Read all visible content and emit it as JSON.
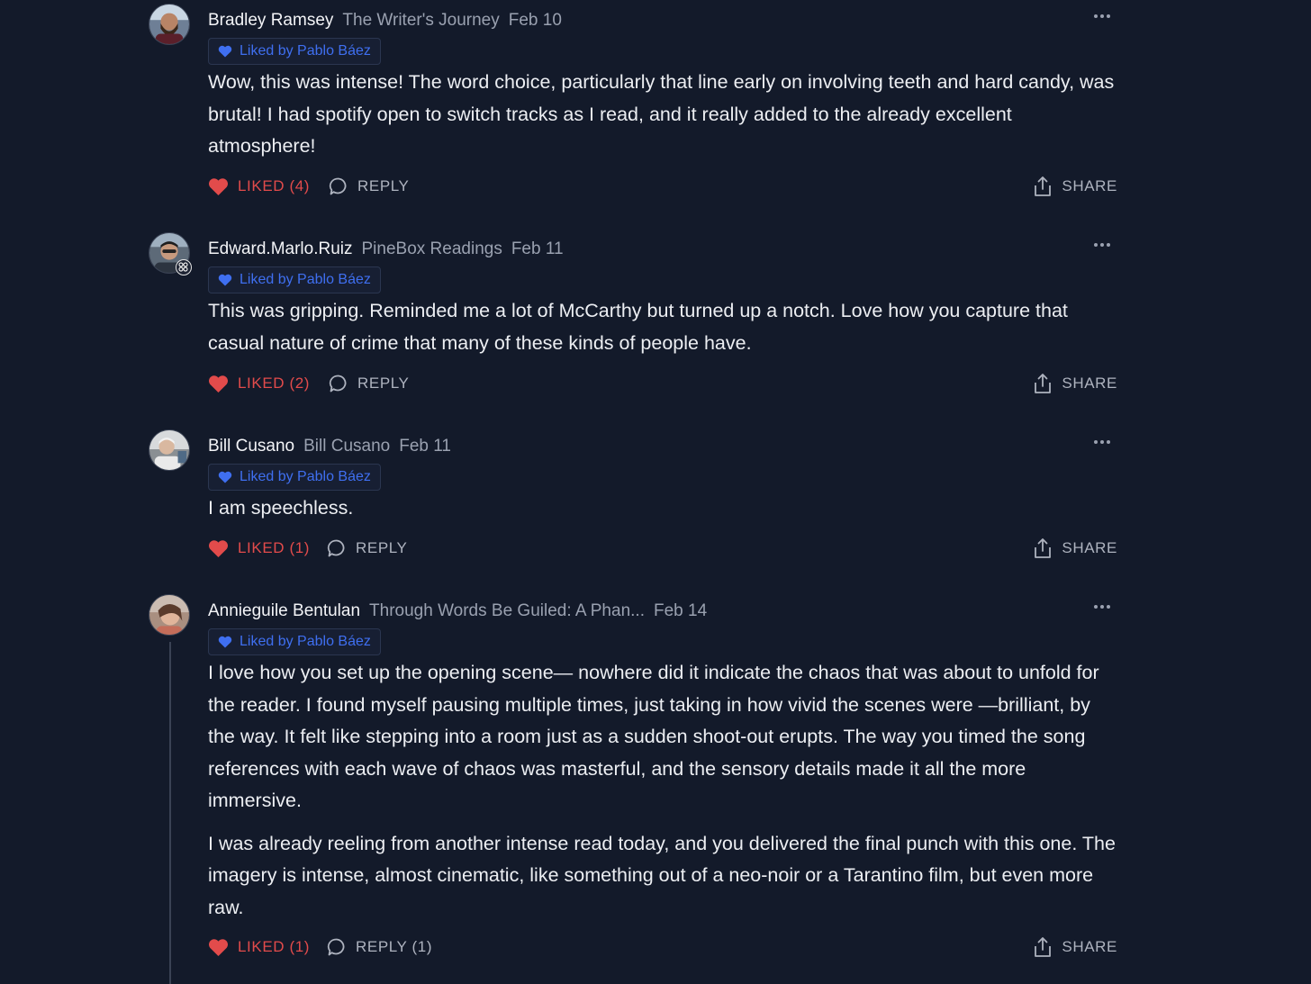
{
  "comments": [
    {
      "author": "Bradley Ramsey",
      "publication": "The Writer's Journey",
      "date": "Feb 10",
      "liked_badge": "Liked by Pablo Báez",
      "body": [
        "Wow, this was intense! The word choice, particularly that line early on involving teeth and hard candy, was brutal! I had spotify open to switch tracks as I read, and it really added to the already excellent atmosphere!"
      ],
      "like_label": "LIKED (4)",
      "reply_label": "REPLY",
      "share_label": "SHARE"
    },
    {
      "author": "Edward.Marlo.Ruiz",
      "publication": "PineBox Readings",
      "date": "Feb 11",
      "liked_badge": "Liked by Pablo Báez",
      "body": [
        "This was gripping. Reminded me a lot of McCarthy but turned up a notch. Love how you capture that casual nature of crime that many of these kinds of people have."
      ],
      "like_label": "LIKED (2)",
      "reply_label": "REPLY",
      "share_label": "SHARE"
    },
    {
      "author": "Bill Cusano",
      "publication": "Bill Cusano",
      "date": "Feb 11",
      "liked_badge": "Liked by Pablo Báez",
      "body": [
        "I am speechless."
      ],
      "like_label": "LIKED (1)",
      "reply_label": "REPLY",
      "share_label": "SHARE"
    },
    {
      "author": "Annieguile Bentulan",
      "publication": "Through Words Be Guiled: A Phan...",
      "date": "Feb 14",
      "liked_badge": "Liked by Pablo Báez",
      "body": [
        "I love how you set up the opening scene— nowhere did it indicate the chaos that was about to unfold for the reader. I found myself pausing multiple times, just taking in how vivid the scenes were —brilliant, by the way. It felt like stepping into a room just as a sudden shoot-out erupts. The way you timed the song references with each wave of chaos was masterful, and the sensory details made it all the more immersive.",
        "I was already reeling from another intense read today, and you delivered the final punch with this one. The imagery is intense, almost cinematic, like something out of a neo-noir or a Tarantino film, but even more raw."
      ],
      "like_label": "LIKED (1)",
      "reply_label": "REPLY (1)",
      "share_label": "SHARE"
    }
  ],
  "colors": {
    "background": "#131a2a",
    "liked": "#e24b4b",
    "badge_text": "#3f6ff0"
  }
}
